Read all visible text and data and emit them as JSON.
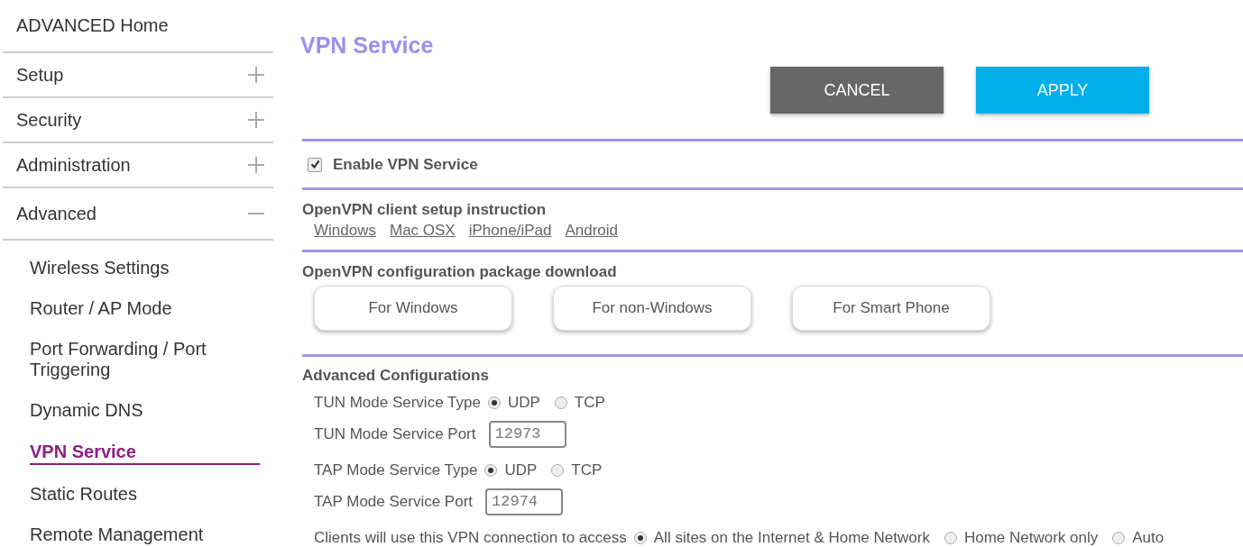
{
  "sidebar": {
    "home": "ADVANCED Home",
    "sections": [
      {
        "label": "Setup",
        "expanded": false
      },
      {
        "label": "Security",
        "expanded": false
      },
      {
        "label": "Administration",
        "expanded": false
      },
      {
        "label": "Advanced",
        "expanded": true
      }
    ],
    "items": [
      {
        "label": "Wireless Settings",
        "selected": false
      },
      {
        "label": "Router / AP Mode",
        "selected": false
      },
      {
        "label": "Port Forwarding / Port Triggering",
        "selected": false
      },
      {
        "label": "Dynamic DNS",
        "selected": false
      },
      {
        "label": "VPN Service",
        "selected": true
      },
      {
        "label": "Static Routes",
        "selected": false
      },
      {
        "label": "Remote Management",
        "selected": false
      }
    ]
  },
  "page": {
    "title": "VPN Service",
    "buttons": [
      {
        "label": "CANCEL",
        "kind": "secondary"
      },
      {
        "label": "APPLY",
        "kind": "primary"
      }
    ],
    "enable": {
      "label": "Enable VPN Service",
      "checked": true
    },
    "instructions": {
      "heading": "OpenVPN client setup instruction",
      "links": [
        "Windows",
        "Mac OSX",
        "iPhone/iPad",
        "Android"
      ]
    },
    "download": {
      "heading": "OpenVPN configuration package download",
      "buttons": [
        "For Windows",
        "For non-Windows",
        "For Smart Phone"
      ]
    },
    "advanced": {
      "heading": "Advanced Configurations",
      "rows": [
        {
          "kind": "radio",
          "label": "TUN Mode Service Type",
          "options": [
            {
              "label": "UDP",
              "selected": true
            },
            {
              "label": "TCP",
              "selected": false
            }
          ]
        },
        {
          "kind": "field",
          "label": "TUN Mode Service Port",
          "value": "12973"
        },
        {
          "kind": "radio",
          "label": "TAP Mode Service Type",
          "options": [
            {
              "label": "UDP",
              "selected": true
            },
            {
              "label": "TCP",
              "selected": false
            }
          ]
        },
        {
          "kind": "field",
          "label": "TAP Mode Service Port",
          "value": "12974"
        },
        {
          "kind": "radio",
          "label": "Clients will use this VPN connection to access",
          "options": [
            {
              "label": "All sites on the Internet & Home Network",
              "selected": true
            },
            {
              "label": "Home Network only",
              "selected": false
            },
            {
              "label": "Auto",
              "selected": false
            }
          ]
        }
      ]
    }
  }
}
